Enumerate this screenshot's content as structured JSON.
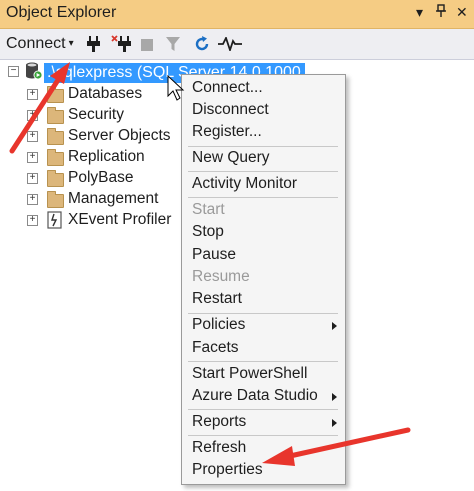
{
  "titlebar": {
    "title": "Object Explorer",
    "dropdown_glyph": "▾",
    "pin_glyph": "⊥",
    "close_glyph": "✕"
  },
  "toolbar": {
    "connect_label": "Connect",
    "caret": "▾",
    "icons": [
      "connect-plug-icon",
      "disconnect-plug-icon",
      "stop-icon",
      "filter-icon",
      "refresh-icon",
      "activity-monitor-icon"
    ]
  },
  "tree": {
    "server_label": ".\\sqlexpress (SQL Server 14.0.1000 - sa)",
    "expander_glyph": "+",
    "collapse_glyph": "−",
    "nodes": [
      {
        "label": "Databases",
        "icon": "folder-icon"
      },
      {
        "label": "Security",
        "icon": "folder-icon"
      },
      {
        "label": "Server Objects",
        "icon": "folder-icon"
      },
      {
        "label": "Replication",
        "icon": "folder-icon"
      },
      {
        "label": "PolyBase",
        "icon": "folder-icon"
      },
      {
        "label": "Management",
        "icon": "folder-icon"
      },
      {
        "label": "XEvent Profiler",
        "icon": "xevent-profiler-icon"
      }
    ]
  },
  "context_menu": {
    "items": [
      {
        "label": "Connect...",
        "enabled": true
      },
      {
        "label": "Disconnect",
        "enabled": true
      },
      {
        "label": "Register...",
        "enabled": true
      },
      {
        "label": "New Query",
        "enabled": true
      },
      {
        "label": "Activity Monitor",
        "enabled": true
      },
      {
        "label": "Start",
        "enabled": false
      },
      {
        "label": "Stop",
        "enabled": true
      },
      {
        "label": "Pause",
        "enabled": true
      },
      {
        "label": "Resume",
        "enabled": false
      },
      {
        "label": "Restart",
        "enabled": true
      },
      {
        "label": "Policies",
        "enabled": true,
        "submenu": true
      },
      {
        "label": "Facets",
        "enabled": true
      },
      {
        "label": "Start PowerShell",
        "enabled": true
      },
      {
        "label": "Azure Data Studio",
        "enabled": true,
        "submenu": true
      },
      {
        "label": "Reports",
        "enabled": true,
        "submenu": true
      },
      {
        "label": "Refresh",
        "enabled": true
      },
      {
        "label": "Properties",
        "enabled": true
      }
    ]
  },
  "colors": {
    "title_bg": "#f5cc84",
    "toolbar_bg": "#eeeef2",
    "selection": "#3399ff",
    "annotation_arrow": "#e8352c",
    "menu_bg": "#f5f5f5",
    "disabled_text": "#9a9a9a"
  }
}
